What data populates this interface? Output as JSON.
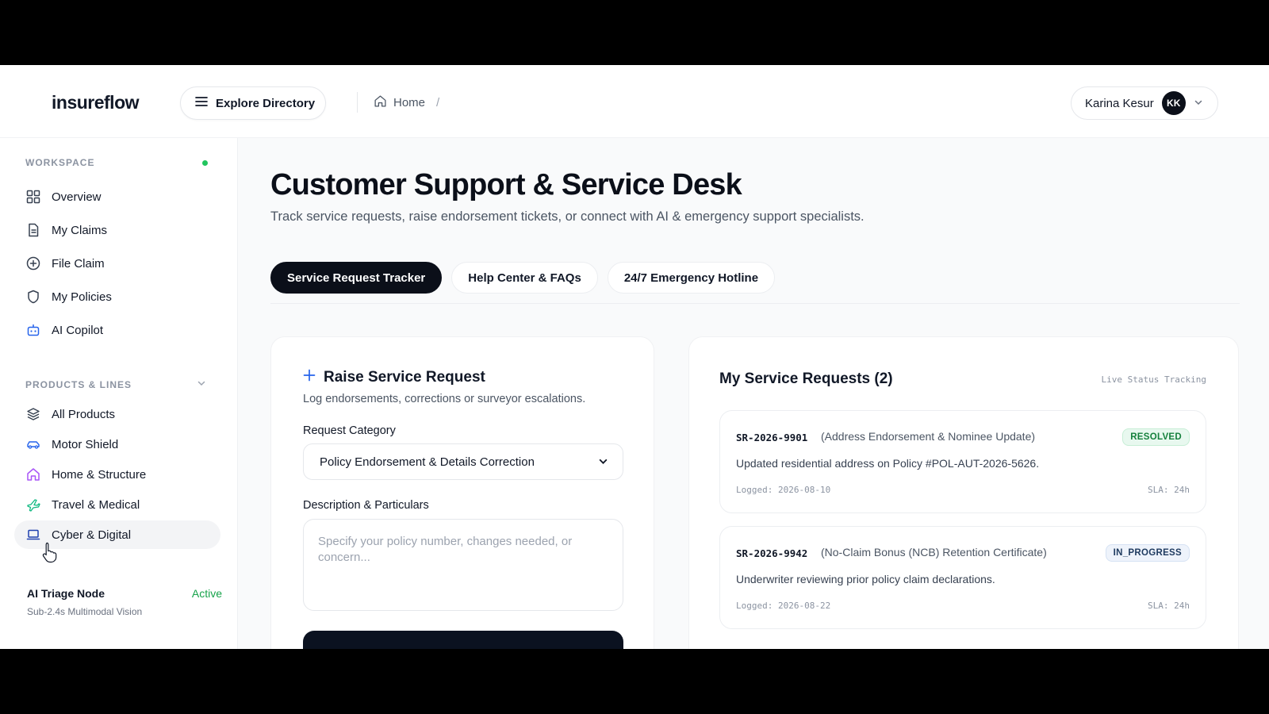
{
  "header": {
    "brand": "insureflow",
    "explore_label": "Explore Directory",
    "breadcrumb_home": "Home",
    "breadcrumb_sep": "/",
    "user_name": "Karina Kesur",
    "user_initials": "KK"
  },
  "sidebar": {
    "workspace_label": "WORKSPACE",
    "workspace_items": [
      {
        "label": "Overview",
        "icon": "grid-icon"
      },
      {
        "label": "My Claims",
        "icon": "document-icon"
      },
      {
        "label": "File Claim",
        "icon": "plus-circle-icon"
      },
      {
        "label": "My Policies",
        "icon": "shield-icon"
      },
      {
        "label": "AI Copilot",
        "icon": "robot-icon"
      }
    ],
    "products_label": "PRODUCTS & LINES",
    "product_items": [
      {
        "label": "All Products",
        "icon": "layers-icon"
      },
      {
        "label": "Motor Shield",
        "icon": "car-icon"
      },
      {
        "label": "Home & Structure",
        "icon": "home-icon"
      },
      {
        "label": "Travel & Medical",
        "icon": "plane-icon"
      },
      {
        "label": "Cyber & Digital",
        "icon": "laptop-icon"
      }
    ],
    "triage": {
      "title": "AI Triage Node",
      "status": "Active",
      "subtitle": "Sub-2.4s Multimodal Vision"
    }
  },
  "main": {
    "title": "Customer Support & Service Desk",
    "subtitle": "Track service requests, raise endorsement tickets, or connect with AI & emergency support specialists.",
    "tabs": [
      {
        "label": "Service Request Tracker",
        "active": true
      },
      {
        "label": "Help Center & FAQs",
        "active": false
      },
      {
        "label": "24/7 Emergency Hotline",
        "active": false
      }
    ]
  },
  "raise_form": {
    "title": "Raise Service Request",
    "subtitle": "Log endorsements, corrections or surveyor escalations.",
    "category_label": "Request Category",
    "category_value": "Policy Endorsement & Details Correction",
    "description_label": "Description & Particulars",
    "description_placeholder": "Specify your policy number, changes needed, or concern..."
  },
  "requests": {
    "title": "My Service Requests (2)",
    "live_label": "Live Status Tracking",
    "items": [
      {
        "id": "SR-2026-9901",
        "type": "(Address Endorsement & Nominee Update)",
        "status": "RESOLVED",
        "description": "Updated residential address on Policy #POL-AUT-2026-5626.",
        "logged": "Logged: 2026-08-10",
        "sla": "SLA: 24h"
      },
      {
        "id": "SR-2026-9942",
        "type": "(No-Claim Bonus (NCB) Retention Certificate)",
        "status": "IN_PROGRESS",
        "description": "Underwriter reviewing prior policy claim declarations.",
        "logged": "Logged: 2026-08-22",
        "sla": "SLA: 24h"
      }
    ]
  },
  "colors": {
    "accent_dark": "#0b0f19",
    "success": "#16a34a",
    "status_dot": "#22c55e"
  }
}
